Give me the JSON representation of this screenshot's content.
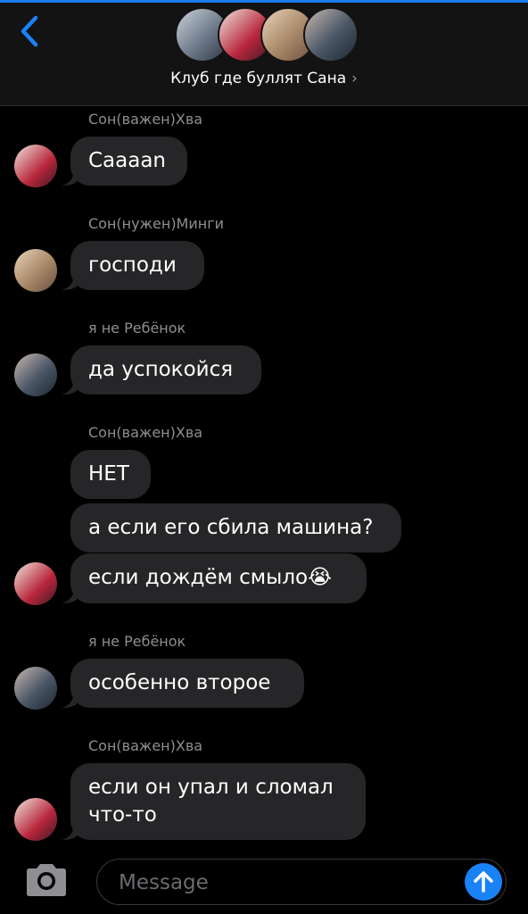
{
  "header": {
    "title": "Клуб где буллят Сана",
    "chevron": "›",
    "back_icon": "chevron-left-icon",
    "accent": "#1a82f7"
  },
  "messages": [
    {
      "sender": "Сон(важен)Хва",
      "text": "Сааааn"
    },
    {
      "sender": "Сон(нужен)Минги",
      "text": "господи"
    },
    {
      "sender": "я не Ребёнок",
      "text": "да успокойся"
    },
    {
      "sender": "Сон(важен)Хва",
      "text": "НЕТ"
    },
    {
      "text": "а если его сбила машина?"
    },
    {
      "text": "если дождём смыло😭"
    },
    {
      "sender": "я не Ребёнок",
      "text": "особенно второе"
    },
    {
      "sender": "Сон(важен)Хва",
      "text": "если он упал и сломал\nчто-то"
    }
  ],
  "composer": {
    "placeholder": "Message",
    "camera_icon": "camera-icon",
    "send_icon": "arrow-up-icon"
  },
  "colors": {
    "background": "#000000",
    "bubble": "#262628",
    "sender": "#8e8e93",
    "send_button": "#1a82f7"
  }
}
